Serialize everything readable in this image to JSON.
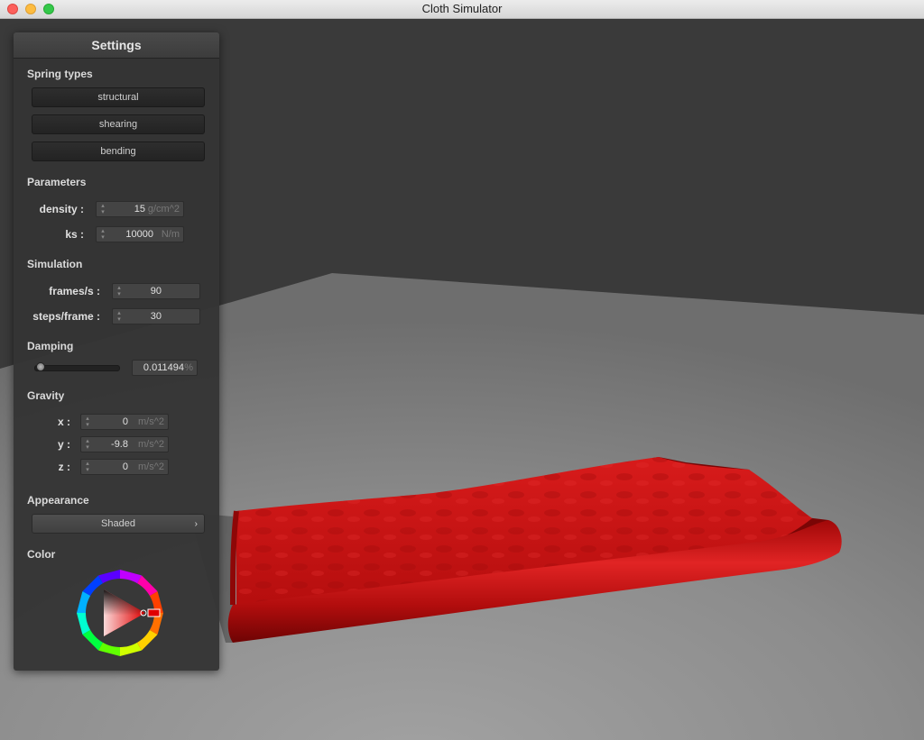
{
  "window": {
    "title": "Cloth Simulator"
  },
  "panel": {
    "title": "Settings",
    "spring_types": {
      "heading": "Spring types",
      "buttons": [
        "structural",
        "shearing",
        "bending"
      ]
    },
    "parameters": {
      "heading": "Parameters",
      "density": {
        "label": "density :",
        "value": "15",
        "unit": "g/cm^2"
      },
      "ks": {
        "label": "ks :",
        "value": "10000",
        "unit": "N/m"
      }
    },
    "simulation": {
      "heading": "Simulation",
      "fps": {
        "label": "frames/s :",
        "value": "90"
      },
      "steps": {
        "label": "steps/frame :",
        "value": "30"
      }
    },
    "damping": {
      "heading": "Damping",
      "value": "0.011494",
      "unit": "%",
      "slider_fraction": 0.011494
    },
    "gravity": {
      "heading": "Gravity",
      "x": {
        "label": "x :",
        "value": "0",
        "unit": "m/s^2"
      },
      "y": {
        "label": "y :",
        "value": "-9.8",
        "unit": "m/s^2"
      },
      "z": {
        "label": "z :",
        "value": "0",
        "unit": "m/s^2"
      }
    },
    "appearance": {
      "heading": "Appearance",
      "selected": "Shaded",
      "chevron": "›"
    },
    "color": {
      "heading": "Color",
      "value": "#ff0000"
    }
  },
  "scene": {
    "background_color": "#333333",
    "cloth_color": "#cc1111"
  }
}
